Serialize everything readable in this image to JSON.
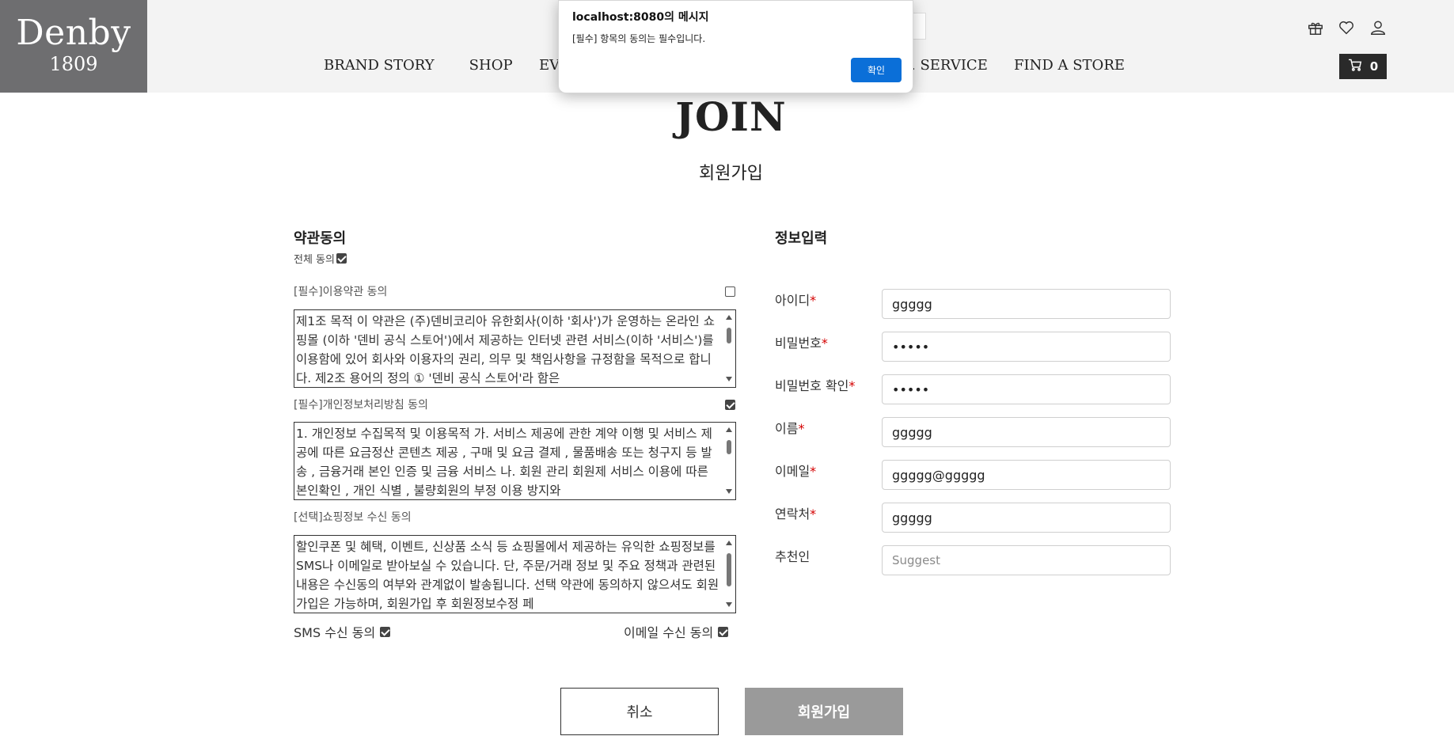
{
  "brand": {
    "name": "Denby",
    "year": "1809"
  },
  "nav": {
    "brand_story": "BRAND STORY",
    "shop": "SHOP",
    "ev": "EV",
    "service": ". SERVICE",
    "find_store": "FIND A STORE"
  },
  "header": {
    "cart_count": "0"
  },
  "dialog": {
    "title": "localhost:8080의 메시지",
    "message": "[필수] 항목의 동의는 필수입니다.",
    "ok": "확인"
  },
  "page": {
    "title": "JOIN",
    "subtitle": "회원가입"
  },
  "terms": {
    "section_title": "약관동의",
    "all_agree": "전체 동의",
    "items": [
      {
        "label": "[필수]이용약관 동의",
        "text": "제1조 목적 이 약관은 (주)덴비코리아 유한회사(이하 '회사')가 운영하는 온라인 쇼핑몰 (이하 '덴비 공식 스토어')에서 제공하는 인터넷 관련 서비스(이하 '서비스')를 이용함에 있어 회사와 이용자의 권리, 의무 및 책임사항을 규정함을 목적으로 합니다. 제2조 용어의 정의 ① '덴비 공식 스토어'라 함은"
      },
      {
        "label": "[필수]개인정보처리방침 동의",
        "text": "1. 개인정보 수집목적 및 이용목적 가. 서비스 제공에 관한 계약 이행 및 서비스 제공에 따른 요금정산 콘텐츠 제공 , 구매 및 요금 결제 , 물품배송 또는 청구지 등 발송 , 금융거래 본인 인증 및 금융 서비스 나. 회원 관리 회원제 서비스 이용에 따른 본인확인 , 개인 식별 , 불량회원의 부정 이용 방지와"
      },
      {
        "label": "[선택]쇼핑정보 수신 동의",
        "text": "할인쿠폰 및 혜택, 이벤트, 신상품 소식 등 쇼핑몰에서 제공하는 유익한 쇼핑정보를 SMS나 이메일로 받아보실 수 있습니다. 단, 주문/거래 정보 및 주요 정책과 관련된 내용은 수신동의 여부와 관계없이 발송됩니다. 선택 약관에 동의하지 않으셔도 회원가입은 가능하며, 회원가입 후 회원정보수정 페"
      }
    ],
    "sms_consent": "SMS 수신 동의",
    "email_consent": "이메일 수신 동의"
  },
  "info": {
    "section_title": "정보입력",
    "fields": [
      {
        "label": "아이디",
        "required": "*",
        "value": "ggggg"
      },
      {
        "label": "비밀번호",
        "required": "*",
        "value": "•••••"
      },
      {
        "label": "비밀번호 확인",
        "required": "*",
        "value": "•••••"
      },
      {
        "label": "이름",
        "required": "*",
        "value": "ggggg"
      },
      {
        "label": "이메일",
        "required": "*",
        "value": "ggggg@ggggg"
      },
      {
        "label": "연락처",
        "required": "*",
        "value": "ggggg"
      },
      {
        "label": "추천인",
        "placeholder": "Suggest"
      }
    ]
  },
  "buttons": {
    "cancel": "취소",
    "join": "회원가입"
  }
}
